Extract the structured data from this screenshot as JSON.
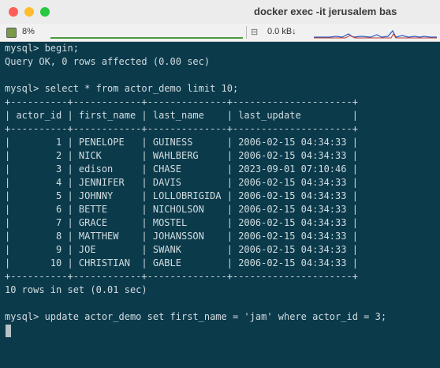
{
  "window": {
    "title": "docker exec -it jerusalem bas"
  },
  "statusbar": {
    "cpu_percent": "8%",
    "net_rate": "0.0 kB↓",
    "icons": [
      "cpu-icon",
      "network-icon"
    ]
  },
  "colors": {
    "terminal_bg": "#0b3a4b",
    "terminal_text": "#d2dde0",
    "traffic_red": "#fd5f57",
    "traffic_yellow": "#febc2e",
    "traffic_green": "#28c840"
  },
  "terminal": {
    "lines": [
      "mysql> begin;",
      "Query OK, 0 rows affected (0.00 sec)",
      "",
      "mysql> select * from actor_demo limit 10;",
      "+----------+------------+--------------+---------------------+",
      "| actor_id | first_name | last_name    | last_update         |",
      "+----------+------------+--------------+---------------------+",
      "|        1 | PENELOPE   | GUINESS      | 2006-02-15 04:34:33 |",
      "|        2 | NICK       | WAHLBERG     | 2006-02-15 04:34:33 |",
      "|        3 | edison     | CHASE        | 2023-09-01 07:10:46 |",
      "|        4 | JENNIFER   | DAVIS        | 2006-02-15 04:34:33 |",
      "|        5 | JOHNNY     | LOLLOBRIGIDA | 2006-02-15 04:34:33 |",
      "|        6 | BETTE      | NICHOLSON    | 2006-02-15 04:34:33 |",
      "|        7 | GRACE      | MOSTEL       | 2006-02-15 04:34:33 |",
      "|        8 | MATTHEW    | JOHANSSON    | 2006-02-15 04:34:33 |",
      "|        9 | JOE        | SWANK        | 2006-02-15 04:34:33 |",
      "|       10 | CHRISTIAN  | GABLE        | 2006-02-15 04:34:33 |",
      "+----------+------------+--------------+---------------------+",
      "10 rows in set (0.01 sec)",
      "",
      "mysql> update actor_demo set first_name = 'jam' where actor_id = 3;"
    ]
  }
}
